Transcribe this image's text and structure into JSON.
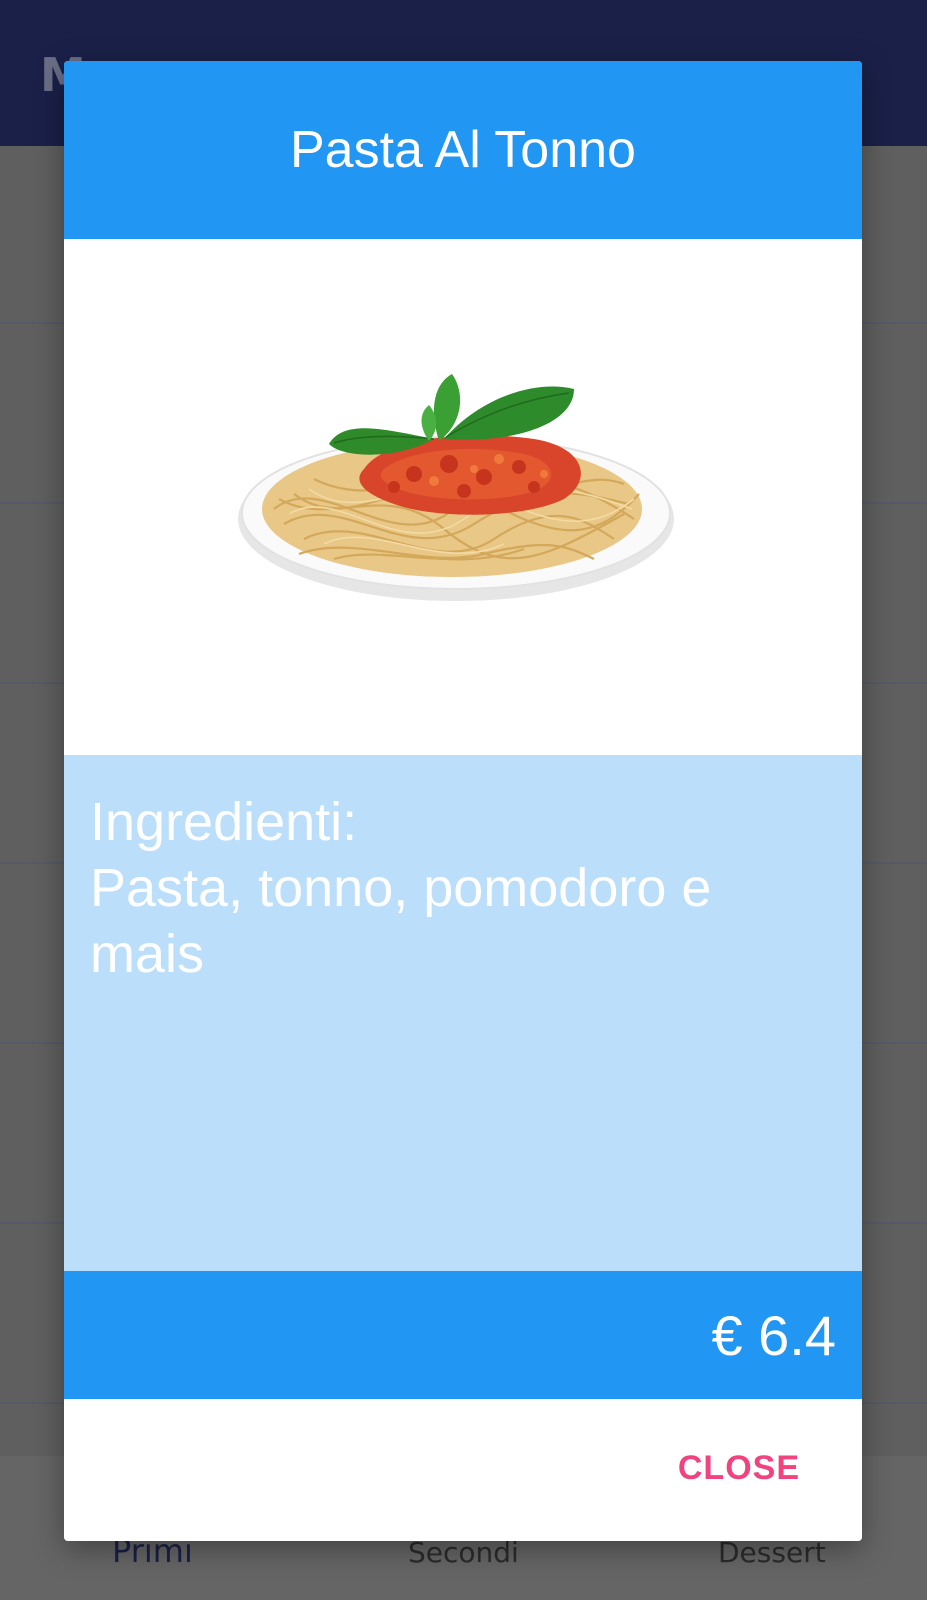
{
  "app": {
    "title": "Menu"
  },
  "bottom_nav": {
    "items": [
      {
        "label": "Primi",
        "active": true
      },
      {
        "label": "Secondi",
        "active": false
      },
      {
        "label": "Dessert",
        "active": false
      }
    ]
  },
  "dialog": {
    "title": "Pasta Al Tonno",
    "image_icon": "pasta-plate-image",
    "ingredients_heading": "Ingredienti:",
    "ingredients_text": "Pasta, tonno, pomodoro e mais",
    "price": "€ 6.4",
    "close_label": "CLOSE"
  },
  "colors": {
    "primary": "#2196f3",
    "primary_dark": "#1a2048",
    "ingredients_bg": "#bbdefb",
    "accent": "#f0437f",
    "scrim": "#5f5f5f"
  }
}
